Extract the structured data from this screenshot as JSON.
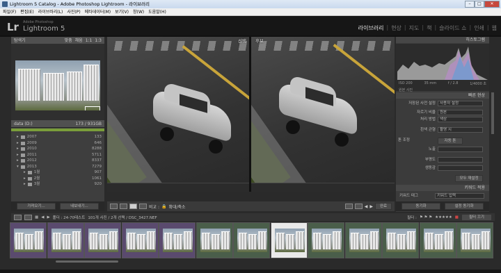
{
  "window": {
    "title": "Lightroom 5 Catalog - Adobe Photoshop Lightroom - 라이브러리"
  },
  "menu": [
    "파일(F)",
    "편집(E)",
    "라이브러리(L)",
    "사진(P)",
    "메타데이터(M)",
    "보기(V)",
    "창(W)",
    "도움말(H)"
  ],
  "identity": {
    "logo": "Lr",
    "brand_small": "Adobe Photoshop",
    "brand": "Lightroom 5"
  },
  "modules": [
    "라이브러리",
    "현상",
    "지도",
    "책",
    "슬라이드 쇼",
    "인쇄",
    "웹"
  ],
  "left_panel": {
    "navigator": {
      "title": "탐색기",
      "zoom": [
        "맞춤",
        "채움",
        "1:1",
        "1:3"
      ]
    },
    "catalog_header": {
      "title": "data (D:)",
      "count": "173 / 931GB"
    },
    "folders": [
      {
        "name": "2007",
        "count": "133"
      },
      {
        "name": "2009",
        "count": "646"
      },
      {
        "name": "2010",
        "count": "8288"
      },
      {
        "name": "2011",
        "count": "5711"
      },
      {
        "name": "2012",
        "count": "8337"
      },
      {
        "name": "2013",
        "count": "7279"
      },
      {
        "name": "1월",
        "count": "907"
      },
      {
        "name": "2월",
        "count": "1061"
      },
      {
        "name": "3월",
        "count": "920"
      }
    ],
    "import_button": "가져오기...",
    "export_button": "내보내기..."
  },
  "compare": {
    "select_label": "선택",
    "candidate_label": "후보"
  },
  "toolbar": {
    "compare_label": "비교 :",
    "zoom_label": "확대/축소",
    "done_label": "완료"
  },
  "right_panel": {
    "histogram": {
      "title": "히스토그램",
      "iso": "ISO 200",
      "focal": "35 mm",
      "aperture": "f / 2.8",
      "shutter": "1/4000 초",
      "original": "원본 사진"
    },
    "quick_develop": {
      "title": "빠른 현상",
      "preset_label": "저장된 사전 설정",
      "preset_value": "사용자 설정",
      "crop_label": "자르기 비율",
      "crop_value": "원본",
      "treatment_label": "처리 방법",
      "treatment_value": "색상",
      "wb_label": "흰색 균형",
      "wb_value": "촬영 시",
      "tone_label": "톤 조정",
      "auto_tone": "자동 톤",
      "exposure": "노출",
      "clarity": "부명도",
      "vibrance": "생동감",
      "reset": "모두 재설정"
    },
    "keywords": {
      "title": "키워드 적용",
      "tags": "키워드 태그",
      "enter": "키워드 입력"
    },
    "sync_meta": "동기화",
    "sync_settings": "설정 동기화"
  },
  "filmstrip": {
    "source": "폴더 : 24-70테스트",
    "info": "101개 사진 / 2개 선택 / DSC_3427.NEF",
    "filter": "필터 :",
    "filter_off": "필터 끄기"
  }
}
